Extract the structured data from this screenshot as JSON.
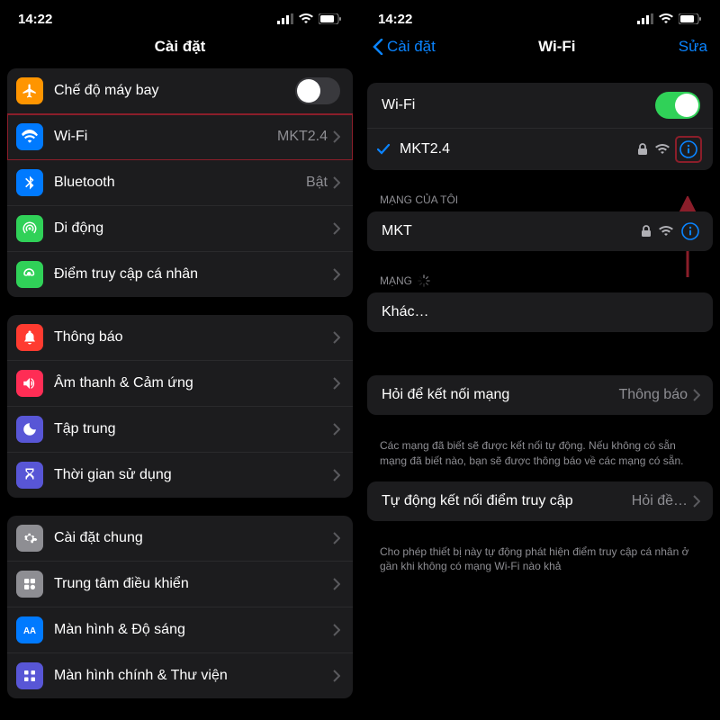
{
  "left": {
    "status_time": "14:22",
    "title": "Cài đặt",
    "rows": [
      {
        "icon": "airplane",
        "color": "#ff9500",
        "label": "Chế độ máy bay",
        "toggle": false
      },
      {
        "icon": "wifi",
        "color": "#007aff",
        "label": "Wi-Fi",
        "value": "MKT2.4",
        "highlight": true
      },
      {
        "icon": "bluetooth",
        "color": "#007aff",
        "label": "Bluetooth",
        "value": "Bật"
      },
      {
        "icon": "cellular",
        "color": "#30d158",
        "label": "Di động"
      },
      {
        "icon": "hotspot",
        "color": "#30d158",
        "label": "Điểm truy cập cá nhân"
      }
    ],
    "group2": [
      {
        "icon": "bell",
        "color": "#ff3b30",
        "label": "Thông báo"
      },
      {
        "icon": "speaker",
        "color": "#ff2d55",
        "label": "Âm thanh & Cảm ứng"
      },
      {
        "icon": "moon",
        "color": "#5856d6",
        "label": "Tập trung"
      },
      {
        "icon": "hourglass",
        "color": "#5856d6",
        "label": "Thời gian sử dụng"
      }
    ],
    "group3": [
      {
        "icon": "gear",
        "color": "#8e8e93",
        "label": "Cài đặt chung"
      },
      {
        "icon": "control",
        "color": "#8e8e93",
        "label": "Trung tâm điều khiển"
      },
      {
        "icon": "display",
        "color": "#007aff",
        "label": "Màn hình & Độ sáng"
      },
      {
        "icon": "home",
        "color": "#5856d6",
        "label": "Màn hình chính & Thư viện"
      }
    ]
  },
  "right": {
    "status_time": "14:22",
    "back": "Cài đặt",
    "title": "Wi-Fi",
    "edit": "Sửa",
    "wifi_toggle_label": "Wi-Fi",
    "connected": {
      "name": "MKT2.4"
    },
    "my_networks_header": "MẠNG CỦA TÔI",
    "my_networks": [
      {
        "name": "MKT"
      }
    ],
    "networks_header": "MẠNG",
    "other_label": "Khác…",
    "ask_row": {
      "label": "Hỏi để kết nối mạng",
      "value": "Thông báo"
    },
    "ask_footer": "Các mạng đã biết sẽ được kết nối tự động. Nếu không có sẵn mạng đã biết nào, bạn sẽ được thông báo về các mạng có sẵn.",
    "auto_row": {
      "label": "Tự động kết nối điểm truy cập",
      "value": "Hỏi đề…"
    },
    "auto_footer": "Cho phép thiết bị này tự động phát hiện điểm truy cập cá nhân ở gần khi không có mạng Wi-Fi nào khả"
  }
}
